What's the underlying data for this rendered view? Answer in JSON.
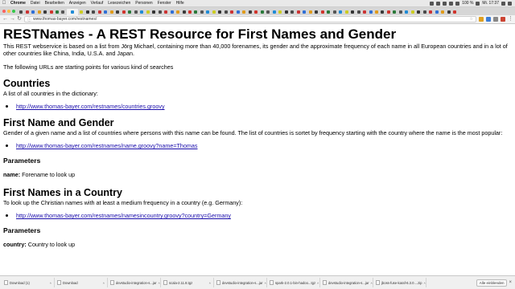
{
  "menubar": {
    "items": [
      "Chrome",
      "Datei",
      "Bearbeiten",
      "Anzeigen",
      "Verlauf",
      "Lesezeichen",
      "Personen",
      "Fenster",
      "Hilfe"
    ],
    "battery": "100 %",
    "clock": "Mi. 17:37"
  },
  "address": {
    "url": "www.thomas-bayer.com/restnames/"
  },
  "page": {
    "title": "RESTNames - A REST Resource for First Names and Gender",
    "intro": "This REST webservice is based on a list from Jörg Michael, containing more than 40,000 forenames, its gender and the approximate frequency of each name in all European countries and in a lot of other countries like China, India, U.S.A. and Japan.",
    "urls_intro": "The following URLs are starting points for various kind of searches",
    "sections": [
      {
        "heading": "Countries",
        "description": "A list of all countries in the dictionary:",
        "link": "http://www.thomas-bayer.com/restnames/countries.groovy"
      },
      {
        "heading": "First Name and Gender",
        "description": "Gender of a given name and a list of countries where persons with this name can be found. The list of countries is sortet by frequency starting with the country where the name is the most popular:",
        "link": "http://www.thomas-bayer.com/restnames/name.groovy?name=Thomas",
        "params_heading": "Parameters",
        "param_name": "name:",
        "param_desc": " Forename to look up"
      },
      {
        "heading": "First Names in a Country",
        "description": "To look up the Christian names with at least a medium frequency in a country (e.g. Germany):",
        "link": "http://www.thomas-bayer.com/restnames/namesincountry.groovy?country=Germany",
        "params_heading": "Parameters",
        "param_name": "country:",
        "param_desc": " Country to look up"
      }
    ]
  },
  "downloads": {
    "items": [
      "Download (1)",
      "Download",
      "devstudio-integration-s...jar",
      "scala-2.11.8.tgz",
      "devstudio-integration-s...jar",
      "spark-2.0.1-bin-hadoo...tgz",
      "devstudio-integration-s...jar",
      "jboss-fuse-karaf-6.3.0....zip"
    ],
    "show_all": "Alle einblenden"
  },
  "colors": {
    "link": "#1a0dab",
    "menubar": "#e9e9e9",
    "tabstrip": "#d6d6d6",
    "toolbar": "#f3f3f3"
  }
}
